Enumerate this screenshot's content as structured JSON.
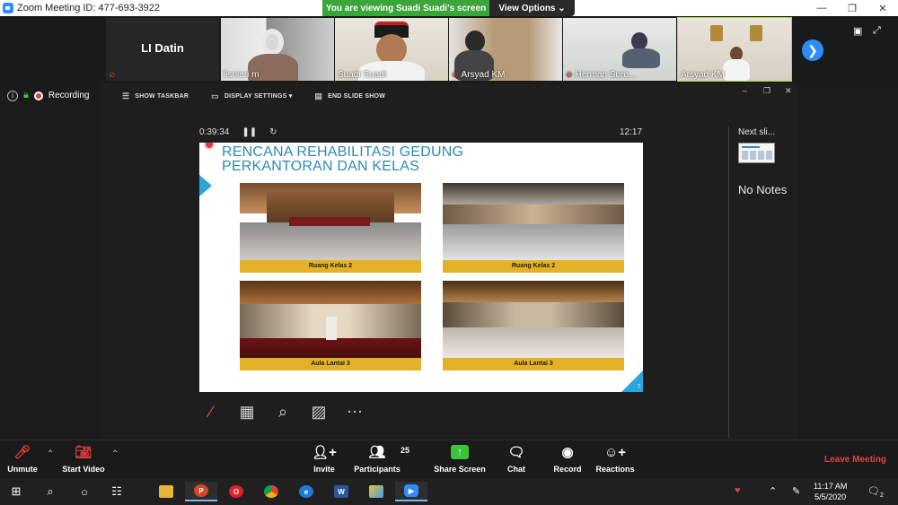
{
  "window": {
    "title": "Zoom Meeting ID: 477-693-3922",
    "minimize": "—",
    "maximize": "❐",
    "close": "✕"
  },
  "share_banner": {
    "viewing_text": "You are viewing Suadi Suadi's screen",
    "view_options_label": "View Options ⌄"
  },
  "participants_strip": [
    {
      "name": "LI Datin",
      "video": false,
      "muted": true
    },
    {
      "name": "lisniari m",
      "video": true,
      "muted": false
    },
    {
      "name": "Suadi Suadi",
      "video": true,
      "muted": false
    },
    {
      "name": "Arsyad KM",
      "video": true,
      "muted": true
    },
    {
      "name": "Herman Suro...",
      "video": true,
      "muted": true
    },
    {
      "name": "Arsyad KM",
      "video": true,
      "muted": false,
      "active": true
    }
  ],
  "status": {
    "recording_label": "Recording"
  },
  "slideshow": {
    "show_taskbar_label": "SHOW TASKBAR",
    "display_settings_label": "DISPLAY SETTINGS ▾",
    "end_slide_show_label": "END SLIDE SHOW",
    "elapsed": "0:39:34",
    "clock": "12:17",
    "next_slide_label": "Next sli...",
    "notes_text": "No Notes",
    "slide": {
      "title_line1": "RENCANA REHABILITASI GEDUNG",
      "title_line2": "PERKANTORAN DAN KELAS",
      "number": "7",
      "photos": [
        {
          "caption": "Ruang Kelas 2"
        },
        {
          "caption": "Ruang Kelas 2"
        },
        {
          "caption": "Aula Lantai 3"
        },
        {
          "caption": "Aula Lantai 3"
        }
      ]
    }
  },
  "toolbar": {
    "unmute_label": "Unmute",
    "start_video_label": "Start Video",
    "invite_label": "Invite",
    "participants_label": "Participants",
    "participants_count": "25",
    "share_screen_label": "Share Screen",
    "chat_label": "Chat",
    "record_label": "Record",
    "reactions_label": "Reactions",
    "leave_label": "Leave Meeting"
  },
  "taskbar": {
    "time": "11:17 AM",
    "date": "5/5/2020",
    "notification_count": "2"
  },
  "colors": {
    "zoom_blue": "#2d8cff",
    "share_green": "#3aa53a",
    "leave_red": "#e0443a",
    "slide_title_blue": "#2f8ab5",
    "caption_gold": "#e3b229"
  }
}
